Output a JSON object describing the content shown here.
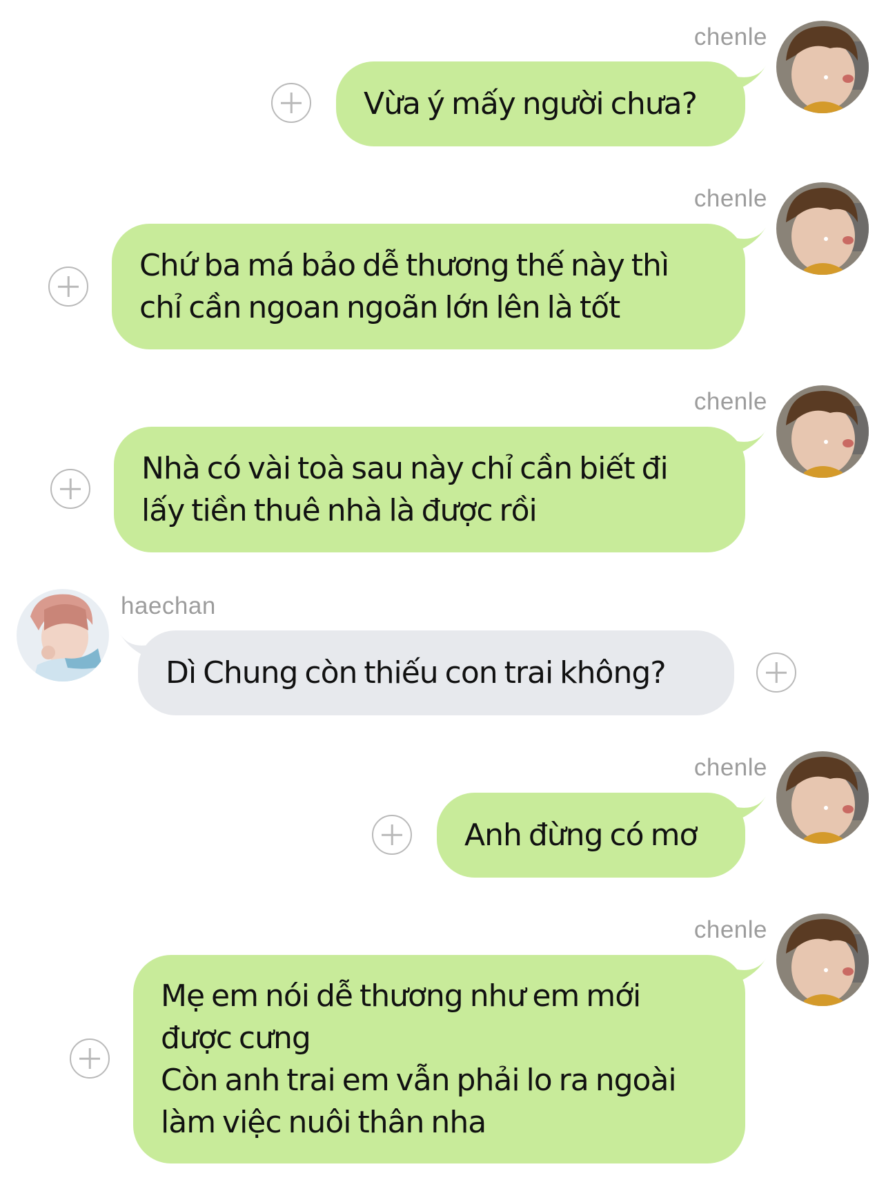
{
  "chat": {
    "messages": [
      {
        "sender": "chenle",
        "direction": "outgoing",
        "text": "Vừa ý mấy người chưa?"
      },
      {
        "sender": "chenle",
        "direction": "outgoing",
        "text": "Chứ ba má bảo dễ thương thế này thì\nchỉ cần ngoan ngoãn lớn lên là tốt"
      },
      {
        "sender": "chenle",
        "direction": "outgoing",
        "text": "Nhà có vài toà sau này chỉ cần biết đi\nlấy tiền thuê nhà là được rồi"
      },
      {
        "sender": "haechan",
        "direction": "incoming",
        "text": "Dì Chung còn thiếu con trai không?"
      },
      {
        "sender": "chenle",
        "direction": "outgoing",
        "text": "Anh đừng có mơ"
      },
      {
        "sender": "chenle",
        "direction": "outgoing",
        "text": "Mẹ em nói dễ thương như em mới\nđược cưng\nCòn anh trai em vẫn phải lo ra ngoài\nlàm việc nuôi thân nha"
      }
    ]
  },
  "colors": {
    "outgoing_bubble": "#c8eb9a",
    "incoming_bubble": "#e7e9ed",
    "name_text": "#9c9c9c",
    "plus_icon": "#b9b9b9"
  },
  "icons": {
    "add": "plus-circle-icon",
    "avatar_chenle": "avatar-chenle",
    "avatar_haechan": "avatar-haechan"
  }
}
